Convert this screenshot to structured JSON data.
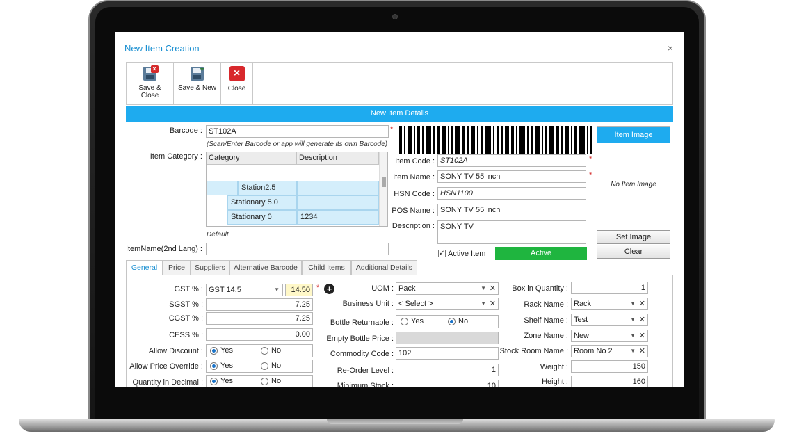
{
  "window": {
    "title": "New Item Creation",
    "close": "×"
  },
  "toolbar": {
    "save_close": "Save & Close",
    "save_new": "Save & New",
    "close": "Close"
  },
  "header": "New Item Details",
  "form": {
    "barcode_label": "Barcode :",
    "barcode_value": "ST102A",
    "barcode_hint": "(Scan/Enter Barcode or app will generate its own Barcode)",
    "item_category_label": "Item Category :",
    "category_headers": [
      "Category",
      "Description"
    ],
    "category_rows": [
      {
        "category": "Station2.5",
        "description": ""
      },
      {
        "category": "Stationary 5.0",
        "description": ""
      },
      {
        "category": "Stationary 0",
        "description": "1234"
      }
    ],
    "category_default": "Default",
    "itemname2_label": "ItemName(2nd Lang) :",
    "itemname2_value": "",
    "item_code_label": "Item Code :",
    "item_code_value": "ST102A",
    "item_name_label": "Item Name :",
    "item_name_value": "SONY TV 55 inch",
    "hsn_label": "HSN Code :",
    "hsn_value": "HSN1100",
    "pos_label": "POS Name :",
    "pos_value": "SONY TV 55 inch",
    "desc_label": "Description :",
    "desc_value": "SONY TV",
    "active_item_label": "Active Item",
    "active_item_checked": "✓",
    "active_status": "Active",
    "required_mark": "*"
  },
  "image": {
    "header": "Item Image",
    "placeholder": "No Item Image",
    "set_image": "Set Image",
    "clear": "Clear"
  },
  "tabs": [
    "General",
    "Price",
    "Suppliers",
    "Alternative Barcode",
    "Child Items",
    "Additional Details"
  ],
  "general": {
    "gst_label": "GST % :",
    "gst_select": "GST 14.5",
    "gst_value": "14.50",
    "sgst_label": "SGST % :",
    "sgst_value": "7.25",
    "cgst_label": "CGST % :",
    "cgst_value": "7.25",
    "cess_label": "CESS % :",
    "cess_value": "0.00",
    "allow_discount_label": "Allow Discount :",
    "allow_price_override_label": "Allow Price Override :",
    "qty_decimal_label": "Quantity in Decimal :",
    "yes": "Yes",
    "no": "No",
    "add_icon": "+",
    "uom_label": "UOM :",
    "uom_value": "Pack",
    "business_unit_label": "Business Unit :",
    "business_unit_value": "< Select >",
    "bottle_returnable_label": "Bottle Returnable :",
    "empty_bottle_price_label": "Empty Bottle Price :",
    "commodity_code_label": "Commodity Code :",
    "commodity_code_value": "102",
    "reorder_label": "Re-Order Level :",
    "reorder_value": "1",
    "min_stock_label": "Minimum Stock :",
    "min_stock_value": "10",
    "box_qty_label": "Box in Quantity :",
    "box_qty_value": "1",
    "rack_label": "Rack Name :",
    "rack_value": "Rack",
    "shelf_label": "Shelf Name :",
    "shelf_value": "Test",
    "zone_label": "Zone Name :",
    "zone_value": "New",
    "stock_room_label": "Stock Room Name :",
    "stock_room_value": "Room No 2",
    "weight_label": "Weight :",
    "weight_value": "150",
    "height_label": "Height :",
    "height_value": "160",
    "dd_arrow": "▼",
    "dd_clear": "✕"
  }
}
